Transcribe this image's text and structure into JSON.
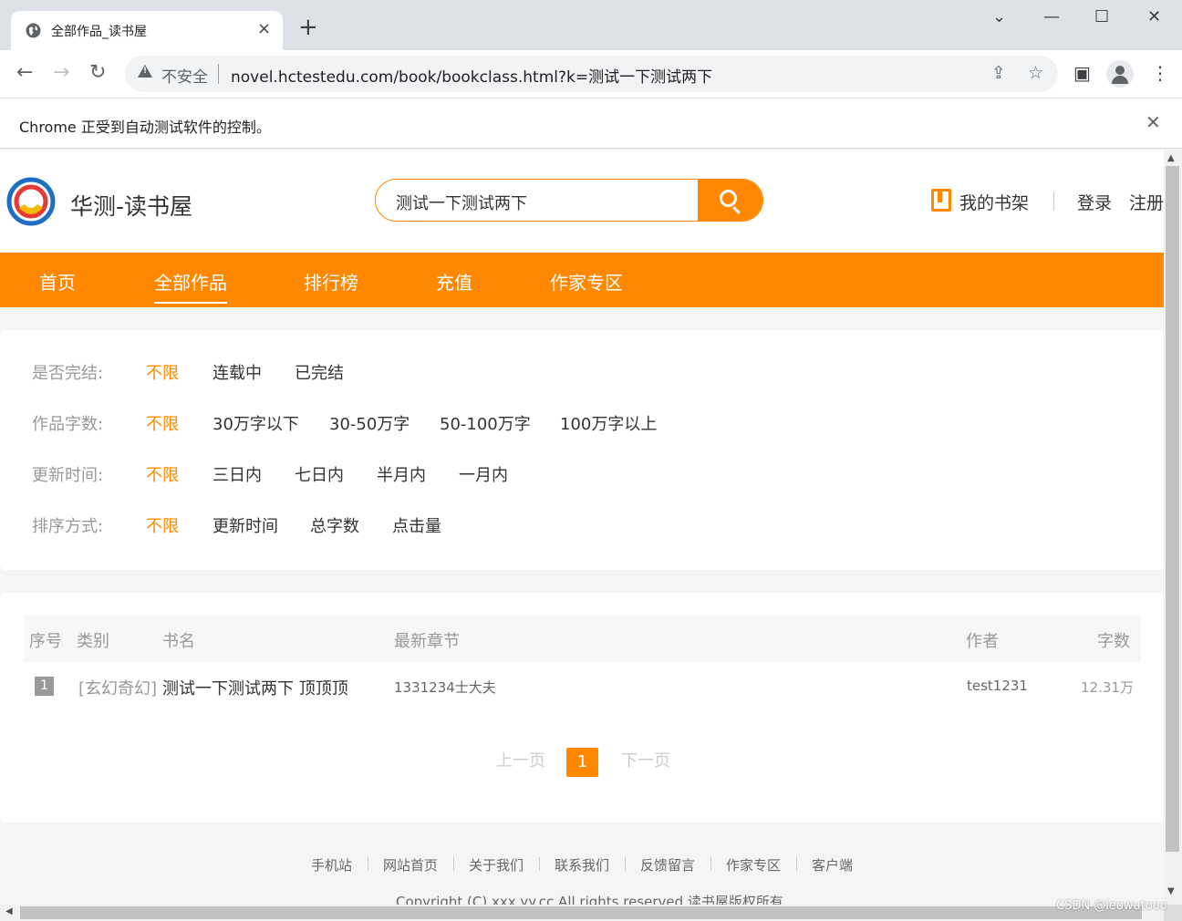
{
  "browser": {
    "tab_title": "全部作品_读书屋",
    "tab_close": "×",
    "new_tab": "+",
    "win_min": "—",
    "win_max": "☐",
    "win_close": "✕",
    "win_dropdown": "⌄",
    "back": "←",
    "forward": "→",
    "reload": "↻",
    "insecure_label": "不安全",
    "url": "novel.hctestedu.com/book/bookclass.html?k=测试一下测试两下",
    "share_icon": "⇪",
    "star_icon": "☆",
    "sidepanel_icon": "▣",
    "menu_icon": "⋮",
    "infobar_text": "Chrome 正受到自动测试软件的控制。",
    "infobar_close": "✕"
  },
  "header": {
    "site_name": "华测-读书屋",
    "search_value": "测试一下测试两下",
    "bookshelf": "我的书架",
    "login": "登录",
    "register": "注册"
  },
  "nav": [
    {
      "label": "首页"
    },
    {
      "label": "全部作品"
    },
    {
      "label": "排行榜"
    },
    {
      "label": "充值"
    },
    {
      "label": "作家专区"
    }
  ],
  "filters": {
    "status": {
      "label": "是否完结:",
      "options": [
        "不限",
        "连载中",
        "已完结"
      ]
    },
    "words": {
      "label": "作品字数:",
      "options": [
        "不限",
        "30万字以下",
        "30-50万字",
        "50-100万字",
        "100万字以上"
      ]
    },
    "updated": {
      "label": "更新时间:",
      "options": [
        "不限",
        "三日内",
        "七日内",
        "半月内",
        "一月内"
      ]
    },
    "sort": {
      "label": "排序方式:",
      "options": [
        "不限",
        "更新时间",
        "总字数",
        "点击量"
      ]
    }
  },
  "table": {
    "headers": [
      "序号",
      "类别",
      "书名",
      "最新章节",
      "作者",
      "字数"
    ],
    "rows": [
      {
        "index": "1",
        "category": "[玄幻奇幻]",
        "title": "测试一下测试两下 顶顶顶",
        "chapter": "1331234士大夫",
        "author": "test1231",
        "words": "12.31万"
      }
    ]
  },
  "pager": {
    "prev": "上一页",
    "current": "1",
    "next": "下一页"
  },
  "footer": {
    "links": [
      "手机站",
      "网站首页",
      "关于我们",
      "联系我们",
      "反馈留言",
      "作家专区",
      "客户端"
    ],
    "copyright": "Copyright (C) xxx.yy.cc All rights reserved  读书屋版权所有"
  },
  "watermark": "CSDN @leowutooo",
  "colors": {
    "accent": "#ff8800"
  }
}
